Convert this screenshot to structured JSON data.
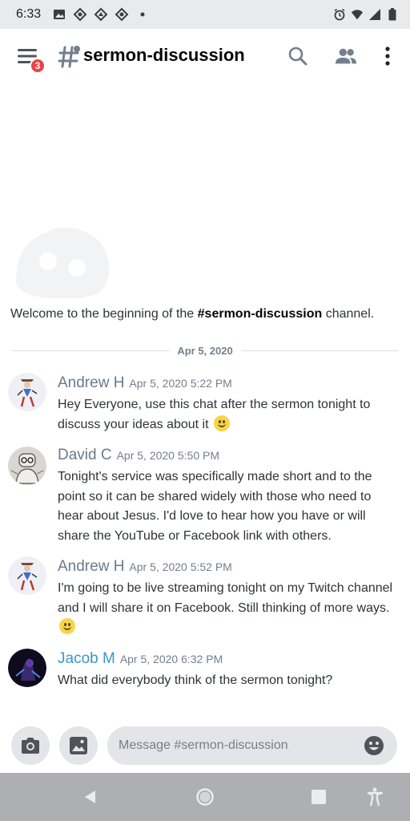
{
  "status_bar": {
    "time": "6:33"
  },
  "header": {
    "badge_count": "3",
    "channel_name": "sermon-discussion"
  },
  "welcome": {
    "prefix": "Welcome to the beginning of the ",
    "channel": "#sermon-discussion",
    "suffix": " channel."
  },
  "divider_date": "Apr 5, 2020",
  "messages": [
    {
      "author": "Andrew H",
      "timestamp": "Apr 5, 2020 5:22 PM",
      "text": "Hey Everyone, use this chat after the sermon tonight to discuss your ideas about it"
    },
    {
      "author": "David C",
      "timestamp": "Apr 5, 2020 5:50 PM",
      "text": "Tonight's service was specifically made short and to the point so it can be shared widely with those who need to hear about Jesus. I'd love to hear how you have or will share the YouTube or Facebook link with others."
    },
    {
      "author": "Andrew H",
      "timestamp": "Apr 5, 2020 5:52 PM",
      "text": "I'm going to be live streaming tonight on my Twitch channel and I will share it on Facebook. Still thinking of more ways."
    },
    {
      "author": "Jacob M",
      "timestamp": "Apr 5, 2020 6:32 PM",
      "text": "What did everybody think of the sermon tonight?"
    }
  ],
  "input": {
    "placeholder": "Message #sermon-discussion"
  },
  "colors": {
    "badge": "#ed4245",
    "author_default": "#6b7a8a",
    "author_blue": "#3c96c8",
    "input_bg": "#e3e5e8"
  }
}
